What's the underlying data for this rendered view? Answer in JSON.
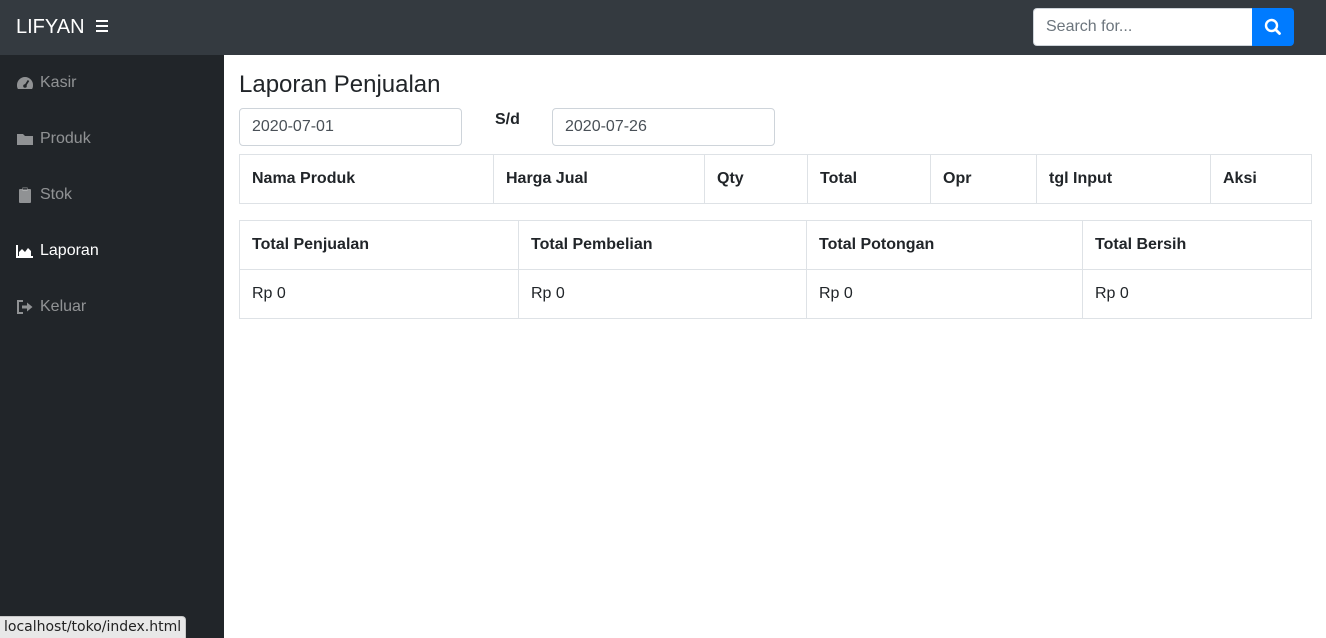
{
  "topbar": {
    "brand": "LIFYAN",
    "toggle_icon": "hamburger-icon",
    "search": {
      "placeholder": "Search for...",
      "value": "",
      "button_icon": "search-icon"
    }
  },
  "sidebar": {
    "items": [
      {
        "label": "Kasir",
        "icon": "tachometer-icon",
        "active": false
      },
      {
        "label": "Produk",
        "icon": "folder-icon",
        "active": false
      },
      {
        "label": "Stok",
        "icon": "clipboard-icon",
        "active": false
      },
      {
        "label": "Laporan",
        "icon": "area-chart-icon",
        "active": true
      },
      {
        "label": "Keluar",
        "icon": "sign-out-icon",
        "active": false
      }
    ]
  },
  "main": {
    "title": "Laporan Penjualan",
    "date_from": "2020-07-01",
    "separator": "S/d",
    "date_to": "2020-07-26",
    "sales_table": {
      "columns": [
        "Nama Produk",
        "Harga Jual",
        "Qty",
        "Total",
        "Opr",
        "tgl Input",
        "Aksi"
      ],
      "rows": []
    },
    "summary_table": {
      "columns": [
        "Total Penjualan",
        "Total Pembelian",
        "Total Potongan",
        "Total Bersih"
      ],
      "values": [
        "Rp 0",
        "Rp 0",
        "Rp 0",
        "Rp 0"
      ]
    }
  },
  "statusbar": {
    "url": "localhost/toko/index.html"
  },
  "colors": {
    "topbar": "#343a40",
    "sidebar": "#212529",
    "accent": "#007bff"
  }
}
